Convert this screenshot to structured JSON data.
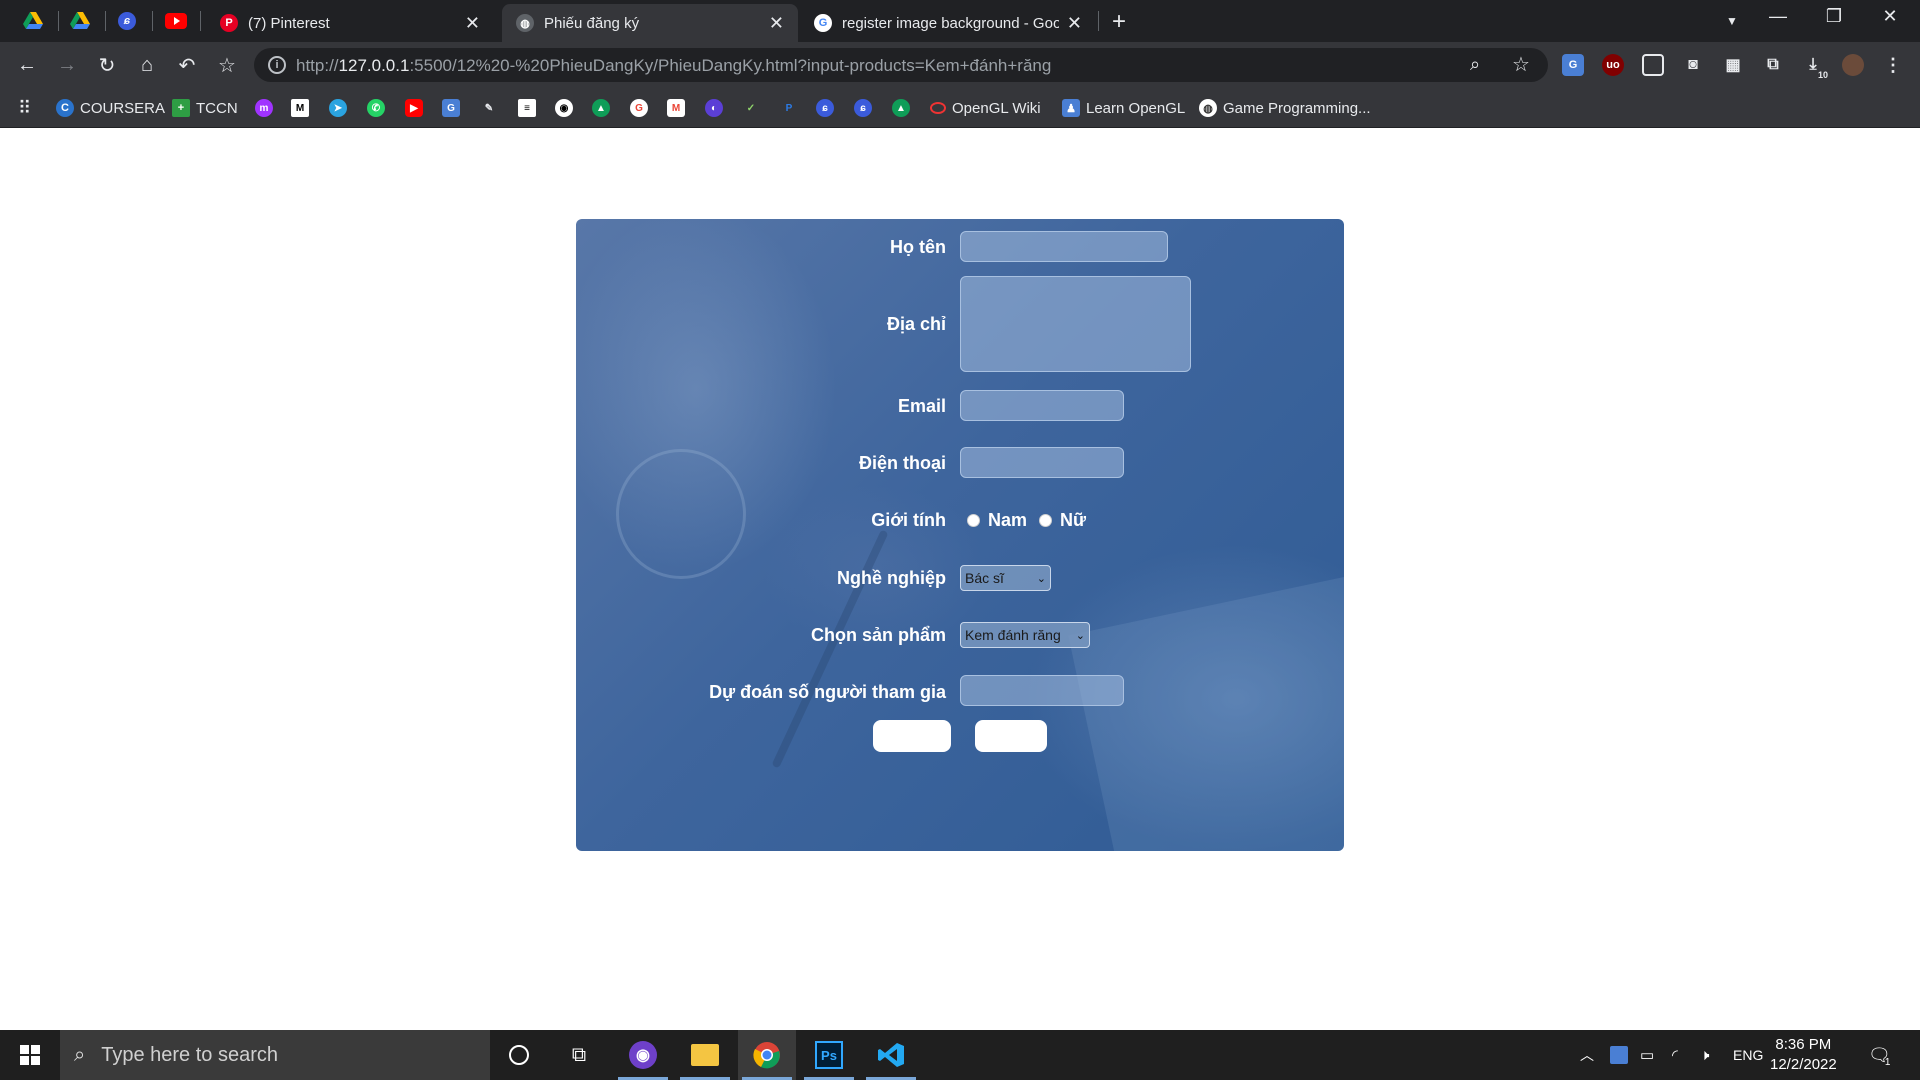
{
  "browser": {
    "tabs": [
      {
        "title": "(7) Pinterest",
        "active": false
      },
      {
        "title": "Phiếu đăng ký",
        "active": true
      },
      {
        "title": "register image background - Goo",
        "active": false
      }
    ],
    "url_prefix": "http://",
    "url_host": "127.0.0.1",
    "url_rest": ":5500/12%20-%20PhieuDangKy/PhieuDangKy.html?input-products=Kem+đánh+răng",
    "download_count": "10",
    "bookmarks": {
      "coursera": "COURSERA",
      "tccn": "TCCN",
      "opengl_wiki": "OpenGL Wiki",
      "learn_opengl": "Learn OpenGL",
      "game_programming": "Game Programming..."
    }
  },
  "form": {
    "fullname_label": "Họ tên",
    "address_label": "Địa chỉ",
    "email_label": "Email",
    "phone_label": "Điện thoại",
    "gender_label": "Giới tính",
    "gender_male": "Nam",
    "gender_female": "Nữ",
    "job_label": "Nghề nghiệp",
    "job_selected": "Bác sĩ",
    "product_label": "Chọn sản phẩm",
    "product_selected": "Kem đánh răng",
    "guess_label": "Dự đoán số người tham gia"
  },
  "taskbar": {
    "search_placeholder": "Type here to search",
    "language": "ENG",
    "time": "8:36 PM",
    "date": "12/2/2022",
    "notification_count": "1"
  }
}
